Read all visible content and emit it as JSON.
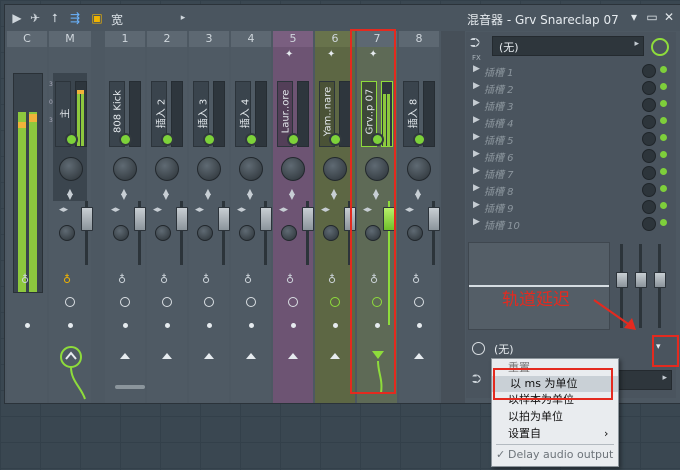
{
  "window": {
    "title": "混音器 - Grv Snareclap 07",
    "toolbar_text": "宽",
    "buttons": {
      "minimize": "▾",
      "restore": "▭",
      "close": "✕"
    }
  },
  "colors": {
    "accent_green": "#7dd23a",
    "annotation_red": "#e42a1f",
    "purple_strip": "#6d5473",
    "olive_strip": "#5d6744"
  },
  "mixer": {
    "strips": [
      {
        "header": "C",
        "label": "",
        "selected": false
      },
      {
        "header": "M",
        "label": "主",
        "selected": false
      },
      {
        "header": "1",
        "label": "808 Kick",
        "selected": false
      },
      {
        "header": "2",
        "label": "插入 2",
        "selected": false
      },
      {
        "header": "3",
        "label": "插入 3",
        "selected": false
      },
      {
        "header": "4",
        "label": "插入 4",
        "selected": false
      },
      {
        "header": "5",
        "label": "Laur..ore",
        "selected": false
      },
      {
        "header": "6",
        "label": "Yam..nare",
        "selected": false
      },
      {
        "header": "7",
        "label": "Grv..p 07",
        "selected": true
      },
      {
        "header": "8",
        "label": "插入 8",
        "selected": false
      }
    ],
    "master_meter_labels": [
      "3",
      "0",
      "3"
    ]
  },
  "panel": {
    "input_preset": "(无)",
    "slots": [
      "插槽 1",
      "插槽 2",
      "插槽 3",
      "插槽 4",
      "插槽 5",
      "插槽 6",
      "插槽 7",
      "插槽 8",
      "插槽 9",
      "插槽 10"
    ],
    "fx_label": "FX",
    "output_preset": "(无)"
  },
  "annotation": {
    "text": "轨道延迟"
  },
  "context_menu": {
    "items": [
      {
        "label": "重置",
        "highlighted": false
      },
      {
        "label": "以 ms 为单位",
        "highlighted": true
      },
      {
        "label": "以样本为单位",
        "highlighted": false
      },
      {
        "label": "以拍为单位",
        "highlighted": false
      },
      {
        "label": "设置自",
        "highlighted": false,
        "submenu": "›"
      },
      {
        "label": "Delay audio output",
        "highlighted": false,
        "checked": "✓"
      }
    ]
  }
}
